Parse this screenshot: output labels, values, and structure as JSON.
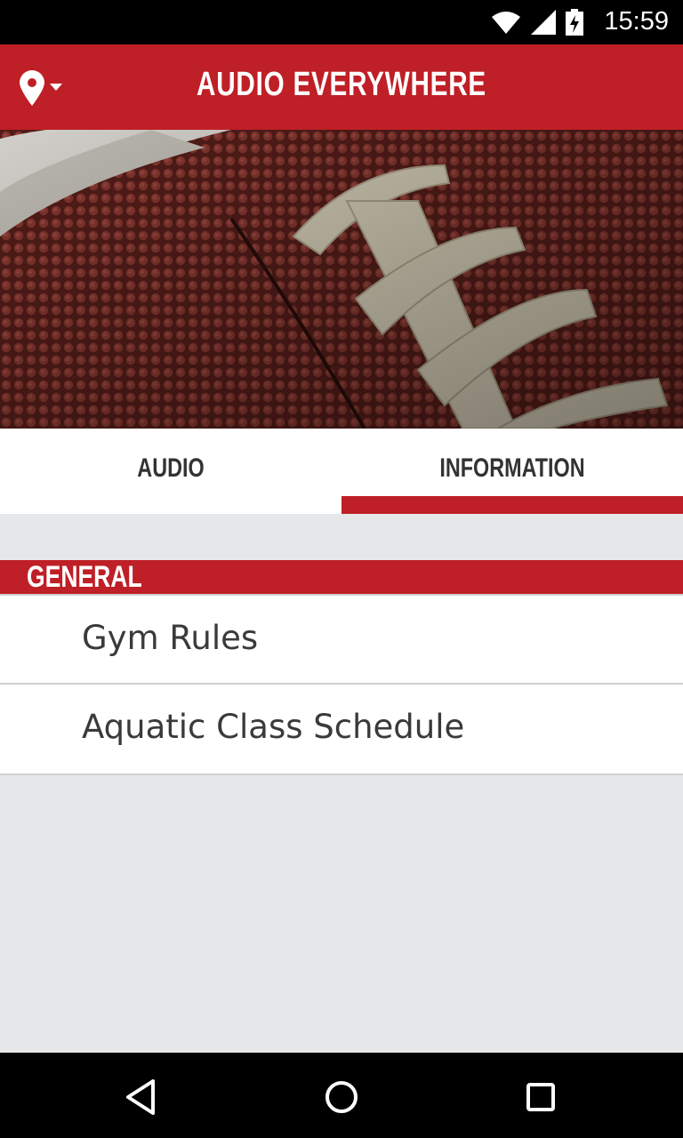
{
  "status_bar": {
    "time": "15:59",
    "icons": [
      "wifi-icon",
      "signal-icon",
      "battery-charging-icon"
    ]
  },
  "app_bar": {
    "title": "AUDIO EVERYWHERE",
    "location_icon": "location-pin-icon",
    "dropdown_icon": "dropdown-arrow-icon"
  },
  "hero": {
    "image": "football-laces-photo"
  },
  "tabs": [
    {
      "label": "AUDIO",
      "selected": false
    },
    {
      "label": "INFORMATION",
      "selected": true
    }
  ],
  "section": {
    "title": "GENERAL"
  },
  "list": [
    {
      "label": "Gym Rules"
    },
    {
      "label": "Aquatic Class Schedule"
    }
  ],
  "nav_bar": {
    "buttons": [
      "back-icon",
      "home-icon",
      "recents-icon"
    ]
  },
  "colors": {
    "accent": "#bf1f26",
    "background": "#e6e7e9"
  }
}
